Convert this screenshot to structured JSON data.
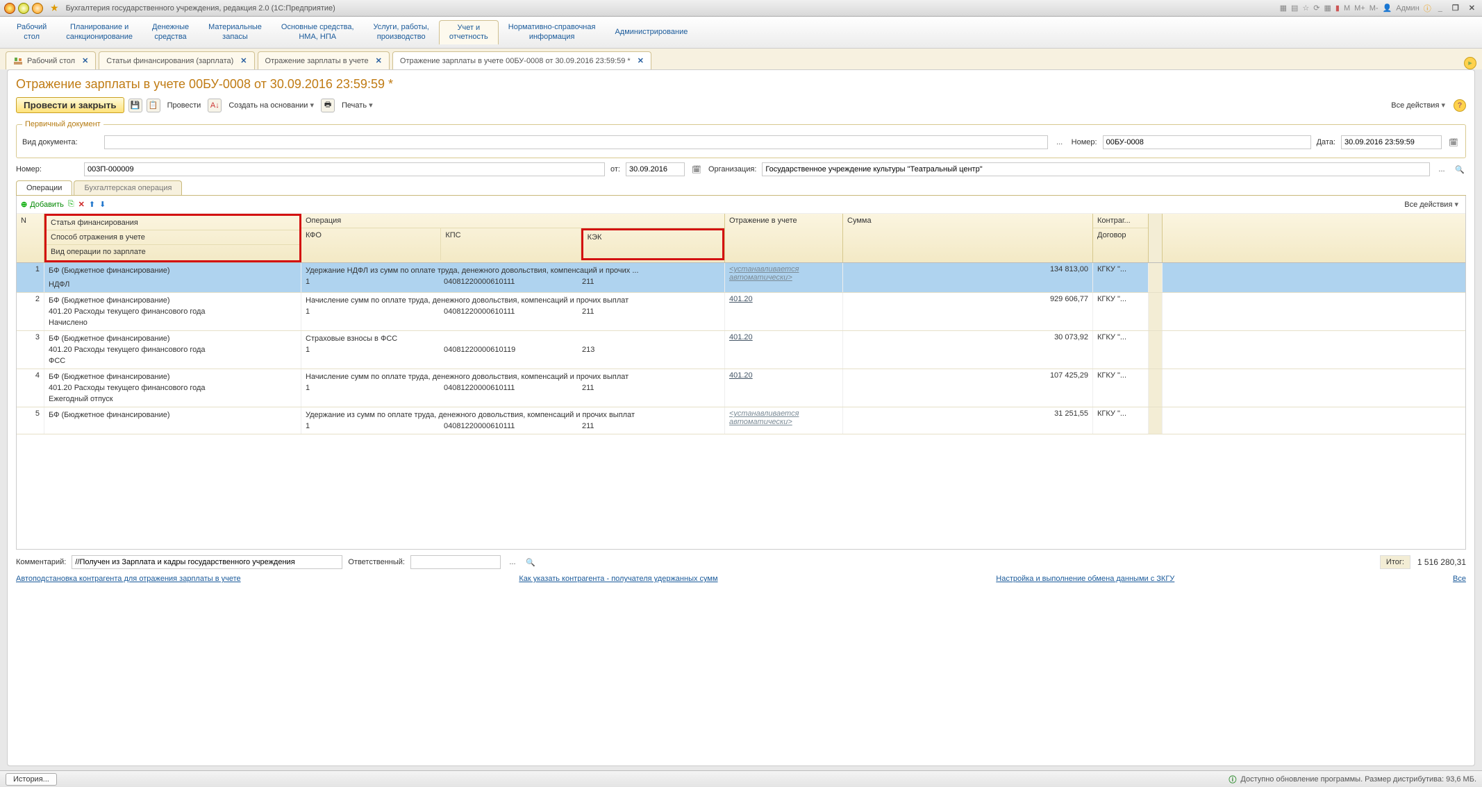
{
  "titlebar": {
    "app_title": "Бухгалтерия государственного учреждения, редакция 2.0  (1С:Предприятие)",
    "user_label": "Админ",
    "m_btns": [
      "M",
      "M+",
      "M-"
    ]
  },
  "mainnav": [
    "Рабочий\nстол",
    "Планирование и\nсанкционирование",
    "Денежные\nсредства",
    "Материальные\nзапасы",
    "Основные средства,\nНМА, НПА",
    "Услуги, работы,\nпроизводство",
    "Учет и\nотчетность",
    "Нормативно-справочная\nинформация",
    "Администрирование"
  ],
  "tabs": [
    {
      "label": "Рабочий стол",
      "closable": true,
      "icon": true
    },
    {
      "label": "Статьи финансирования (зарплата)",
      "closable": true
    },
    {
      "label": "Отражение зарплаты в учете",
      "closable": true
    },
    {
      "label": "Отражение зарплаты в учете 00БУ-0008 от 30.09.2016 23:59:59 *",
      "closable": true,
      "active": true
    }
  ],
  "page": {
    "title": "Отражение зарплаты в учете 00БУ-0008 от 30.09.2016 23:59:59 *",
    "toolbar": {
      "run_close": "Провести и закрыть",
      "run": "Провести",
      "create_on": "Создать на основании",
      "print": "Печать",
      "all_actions": "Все действия"
    },
    "primary_fs": "Первичный документ",
    "fields": {
      "doc_type_lbl": "Вид документа:",
      "doc_type_val": "",
      "nomer_lbl": "Номер:",
      "nomer_val": "00БУ-0008",
      "date_lbl": "Дата:",
      "date_val": "30.09.2016 23:59:59",
      "inner_nomer_lbl": "Номер:",
      "inner_nomer_val": "003П-000009",
      "ot_lbl": "от:",
      "ot_val": "30.09.2016",
      "org_lbl": "Организация:",
      "org_val": "Государственное учреждение культуры \"Театральный центр\""
    },
    "inner_tabs": {
      "op": "Операции",
      "buh": "Бухгалтерская операция"
    },
    "grid_toolbar": {
      "add": "Добавить",
      "all_actions": "Все действия"
    },
    "grid_head": {
      "n": "N",
      "fin1": "Статья финансирования",
      "fin2": "Способ отражения в учете",
      "fin3": "Вид операции по зарплате",
      "op": "Операция",
      "kfo": "КФО",
      "kps": "КПС",
      "kek": "КЭК",
      "ref": "Отражение в учете",
      "sum": "Сумма",
      "kag": "Контраг...",
      "dog": "Договор"
    },
    "rows": [
      {
        "n": "1",
        "fin": "БФ (Бюджетное финансирование)",
        "f2": "",
        "f3": "НДФЛ",
        "op": "Удержание НДФЛ из сумм по оплате труда, денежного довольствия, компенсаций и прочих ...",
        "kfo": "1",
        "kps": "04081220000610111",
        "kek": "211",
        "ref_auto": "<устанавливается автоматически>",
        "sum": "134 813,00",
        "kag": "КГКУ \"...",
        "sel": true
      },
      {
        "n": "2",
        "fin": "БФ (Бюджетное финансирование)",
        "f2": "401.20 Расходы текущего финансового года",
        "f3": "Начислено",
        "op": "Начисление сумм по оплате труда, денежного довольствия, компенсаций и прочих выплат",
        "kfo": "1",
        "kps": "04081220000610111",
        "kek": "211",
        "ref": "401.20",
        "sum": "929 606,77",
        "kag": "КГКУ \"..."
      },
      {
        "n": "3",
        "fin": "БФ (Бюджетное финансирование)",
        "f2": "401.20 Расходы текущего финансового года",
        "f3": "ФСС",
        "op": "Страховые взносы в ФСС",
        "kfo": "1",
        "kps": "04081220000610119",
        "kek": "213",
        "ref": "401.20",
        "sum": "30 073,92",
        "kag": "КГКУ \"..."
      },
      {
        "n": "4",
        "fin": "БФ (Бюджетное финансирование)",
        "f2": "401.20 Расходы текущего финансового года",
        "f3": "Ежегодный отпуск",
        "op": "Начисление сумм по оплате труда, денежного довольствия, компенсаций и прочих выплат",
        "kfo": "1",
        "kps": "04081220000610111",
        "kek": "211",
        "ref": "401.20",
        "sum": "107 425,29",
        "kag": "КГКУ \"..."
      },
      {
        "n": "5",
        "fin": "БФ (Бюджетное финансирование)",
        "f2": "",
        "f3": "",
        "op": "Удержание из сумм по оплате труда, денежного довольствия, компенсаций и прочих выплат",
        "kfo": "1",
        "kps": "04081220000610111",
        "kek": "211",
        "ref_auto": "<устанавливается автоматически>",
        "sum": "31 251,55",
        "kag": "КГКУ \"..."
      }
    ],
    "bottom": {
      "comment_lbl": "Комментарий:",
      "comment_val": "//Получен из Зарплата и кадры государственного учреждения",
      "resp_lbl": "Ответственный:",
      "resp_val": "",
      "itog_lbl": "Итог:",
      "itog_val": "1 516 280,31"
    },
    "links": {
      "l1": "Автоподстановка контрагента для отражения зарплаты в учете",
      "l2": "Как указать контрагента - получателя удержанных сумм",
      "l3": "Настройка и выполнение обмена данными с ЗКГУ",
      "all": "Все"
    }
  },
  "statusbar": {
    "history": "История...",
    "update": "Доступно обновление программы. Размер дистрибутива: 93,6 МБ."
  }
}
